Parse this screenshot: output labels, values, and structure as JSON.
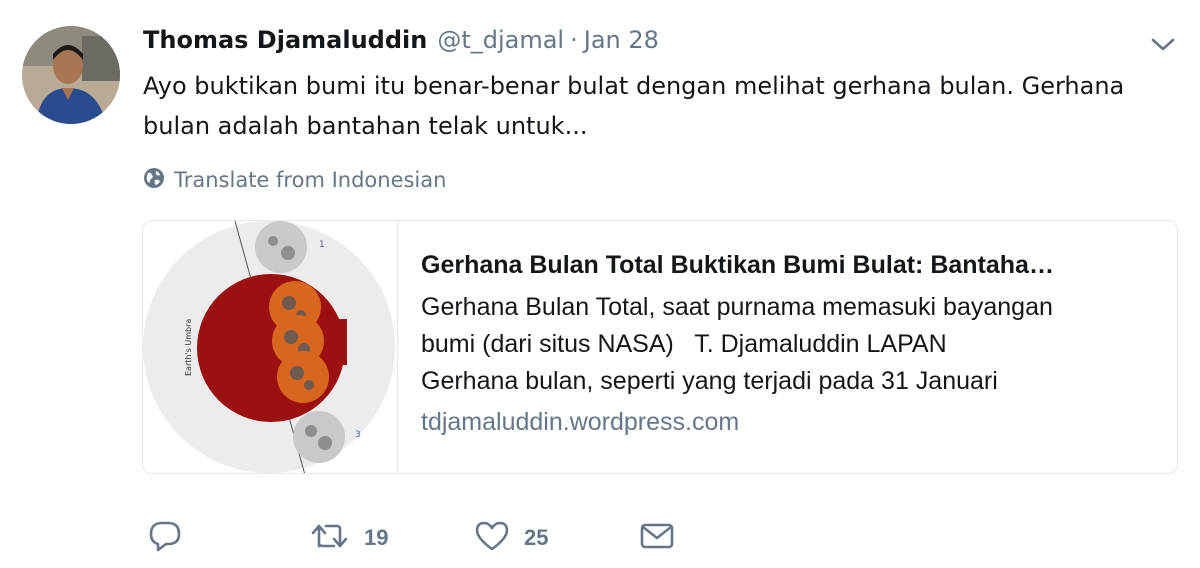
{
  "tweet": {
    "author_name": "Thomas Djamaluddin",
    "author_handle": "@t_djamal",
    "separator": "·",
    "date": "Jan 28",
    "text": "Ayo buktikan bumi itu benar-benar bulat dengan melihat gerhana bulan. Gerhana bulan adalah bantahan telak untuk...",
    "translate_label": "Translate from Indonesian"
  },
  "card": {
    "title": "Gerhana Bulan Total Buktikan Bumi Bulat: Bantaha…",
    "description": "Gerhana Bulan Total, saat purnama memasuki bayangan\nbumi (dari situs NASA)   T. Djamaluddin LAPAN\nGerhana bulan, seperti yang terjadi pada 31 Januari",
    "domain": "tdjamaluddin.wordpress.com",
    "image_label": "Earth's Umbra"
  },
  "actions": {
    "reply_count": "",
    "retweet_count": "19",
    "like_count": "25"
  },
  "icons": [
    "reply-icon",
    "retweet-icon",
    "like-icon",
    "message-icon",
    "globe-icon",
    "chevron-down-icon"
  ],
  "colors": {
    "text": "#14171a",
    "muted": "#657786",
    "border": "#e1e8ed",
    "umbra": "#9b1010",
    "moon_eclipse": "#d8661e"
  }
}
